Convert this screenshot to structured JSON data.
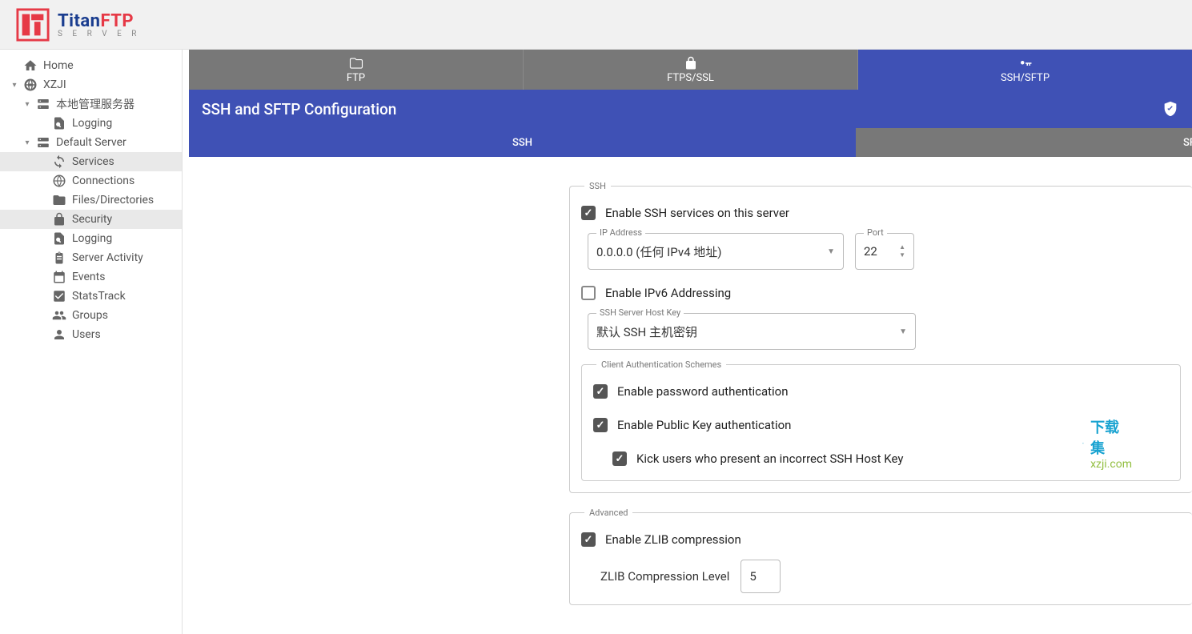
{
  "logo": {
    "main1": "Titan",
    "main2": "FTP",
    "sub": "S E R V E R"
  },
  "sidebar": {
    "home": "Home",
    "domain": "XZJI",
    "local_admin": "本地管理服务器",
    "logging_admin": "Logging",
    "default_server": "Default Server",
    "items": {
      "services": "Services",
      "connections": "Connections",
      "files": "Files/Directories",
      "security": "Security",
      "logging": "Logging",
      "activity": "Server Activity",
      "events": "Events",
      "stats": "StatsTrack",
      "groups": "Groups",
      "users": "Users"
    }
  },
  "tabs": {
    "ftp": "FTP",
    "ftps": "FTPS/SSL",
    "ssh": "SSH/SFTP"
  },
  "title": "SSH and SFTP Configuration",
  "subtabs": {
    "ssh": "SSH",
    "sftp": "SF"
  },
  "ssh": {
    "legend": "SSH",
    "enable": "Enable SSH services on this server",
    "ip_label": "IP Address",
    "ip_value": "0.0.0.0 (任何 IPv4 地址)",
    "port_label": "Port",
    "port_value": "22",
    "ipv6": "Enable IPv6 Addressing",
    "hostkey_label": "SSH Server Host Key",
    "hostkey_value": "默认 SSH 主机密钥"
  },
  "auth": {
    "legend": "Client Authentication Schemes",
    "password": "Enable password authentication",
    "pubkey": "Enable Public Key authentication",
    "kick": "Kick users who present an incorrect SSH Host Key"
  },
  "adv": {
    "legend": "Advanced",
    "zlib": "Enable ZLIB compression",
    "zlib_level": "ZLIB Compression Level",
    "zlib_value": "5"
  },
  "watermark": {
    "cn": "下载集",
    "en": "xzji.com"
  }
}
